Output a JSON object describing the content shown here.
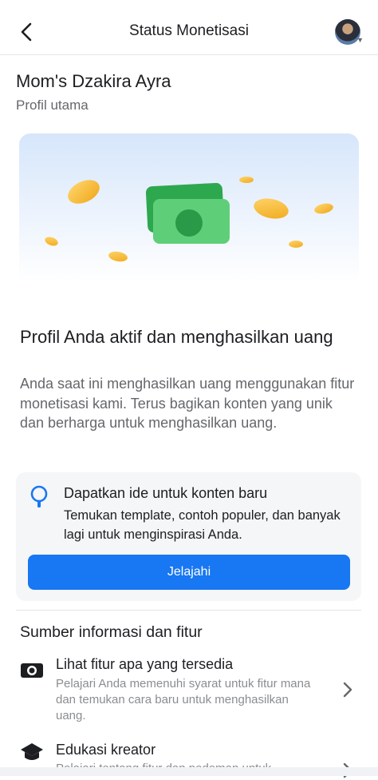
{
  "header": {
    "title": "Status Monetisasi",
    "back_icon": "chevron-left-icon",
    "avatar_icon": "profile-avatar"
  },
  "profile": {
    "name": "Mom's Dzakira Ayra",
    "subtitle": "Profil utama"
  },
  "status": {
    "headline": "Profil Anda aktif dan menghasilkan uang",
    "description": "Anda saat ini menghasilkan uang menggunakan fitur monetisasi kami. Terus bagikan konten yang unik dan berharga untuk menghasilkan uang."
  },
  "tip_card": {
    "icon": "lightbulb-icon",
    "title": "Dapatkan ide untuk konten baru",
    "description": "Temukan template, contoh populer, dan banyak lagi untuk menginspirasi Anda.",
    "button_label": "Jelajahi"
  },
  "resources": {
    "title": "Sumber informasi dan fitur",
    "items": [
      {
        "icon": "camera-icon",
        "title": "Lihat fitur apa yang tersedia",
        "description": "Pelajari Anda memenuhi syarat untuk fitur mana dan temukan cara baru untuk menghasilkan uang."
      },
      {
        "icon": "graduation-cap-icon",
        "title": "Edukasi kreator",
        "description": "Pelajari tentang fitur dan pedoman untuk"
      }
    ]
  },
  "colors": {
    "primary": "#1877f2",
    "text": "#1c1e21",
    "muted": "#65676b",
    "card_bg": "#f5f6f7"
  }
}
